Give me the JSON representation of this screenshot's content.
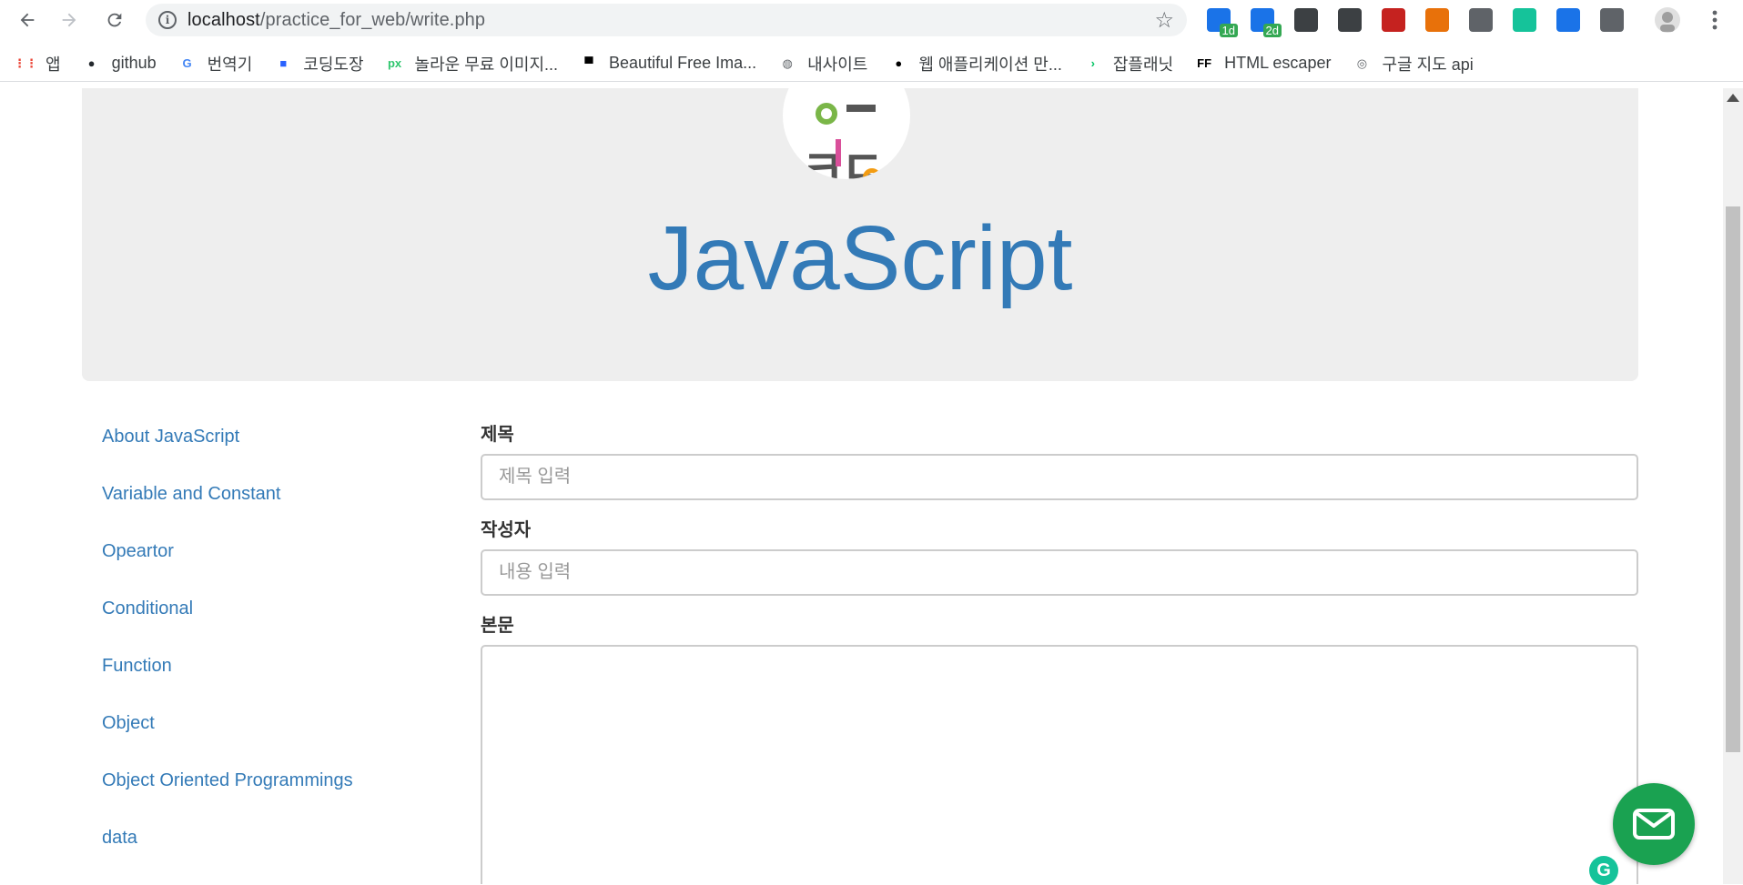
{
  "browser": {
    "url_host": "localhost",
    "url_path": "/practice_for_web/write.php",
    "extensions": [
      {
        "icon": "calendar-icon",
        "badge": "1d",
        "color": "#1a73e8"
      },
      {
        "icon": "gmail-icon",
        "badge": "2d",
        "color": "#1a73e8"
      },
      {
        "icon": "lightbulb-icon",
        "badge": "",
        "color": "#3c4043"
      },
      {
        "icon": "info-box-icon",
        "badge": "",
        "color": "#3c4043"
      },
      {
        "icon": "cast-icon",
        "badge": "",
        "color": "#c5221f"
      },
      {
        "icon": "ex-icon",
        "badge": "",
        "color": "#e8710a"
      },
      {
        "icon": "drive-icon",
        "badge": "",
        "color": "#5f6368"
      },
      {
        "icon": "grammarly-icon",
        "badge": "",
        "color": "#15c39a"
      },
      {
        "icon": "clock-icon",
        "badge": "",
        "color": "#1a73e8"
      },
      {
        "icon": "tag-icon",
        "badge": "",
        "color": "#5f6368"
      }
    ]
  },
  "bookmarks": [
    {
      "label": "앱",
      "icon": "apps-grid-icon"
    },
    {
      "label": "github",
      "icon": "github-icon"
    },
    {
      "label": "번역기",
      "icon": "google-icon"
    },
    {
      "label": "코딩도장",
      "icon": "dojang-icon"
    },
    {
      "label": "놀라운 무료 이미지...",
      "icon": "pixabay-icon"
    },
    {
      "label": "Beautiful Free Ima...",
      "icon": "unsplash-icon"
    },
    {
      "label": "내사이트",
      "icon": "globe-icon"
    },
    {
      "label": "웹 애플리케이션 만...",
      "icon": "circle-icon"
    },
    {
      "label": "잡플래닛",
      "icon": "jobplanet-icon"
    },
    {
      "label": "HTML escaper",
      "icon": "ff-icon"
    },
    {
      "label": "구글 지도 api",
      "icon": "maps-icon"
    }
  ],
  "page": {
    "title": "JavaScript",
    "nav": [
      "About JavaScript",
      "Variable and Constant",
      "Opeartor",
      "Conditional",
      "Function",
      "Object",
      "Object Oriented Programmings",
      "data"
    ],
    "form": {
      "title_label": "제목",
      "title_placeholder": "제목 입력",
      "author_label": "작성자",
      "author_placeholder": "내용 입력",
      "body_label": "본문"
    }
  }
}
